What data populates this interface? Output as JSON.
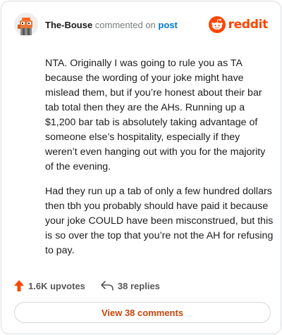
{
  "header": {
    "username": "The-Bouse",
    "action_text": "commented on",
    "post_link": "post",
    "logo_text": "reddit"
  },
  "comment": {
    "paragraphs": [
      "NTA. Originally I was going to rule you as TA because the wording of your joke might have mislead them, but if you’re honest about their bar tab total then they are the AHs. Running up a $1,200 bar tab is absolutely taking advantage of someone else’s hospitality, especially if they weren’t even hanging out with you for the majority of the evening.",
      "Had they run up a tab of only a few hundred dollars then tbh you probably should have paid it because your joke COULD have been misconstrued, but this is so over the top that you’re not the AH for refusing to pay."
    ]
  },
  "actions": {
    "upvotes": "1.6K upvotes",
    "replies": "38 replies",
    "view_comments": "View 38 comments"
  },
  "colors": {
    "brand": "#ff4500",
    "link": "#0079d3",
    "upvote_arrow": "#ff4500"
  },
  "icons": {
    "avatar": "user-avatar",
    "logo": "reddit-snoo-icon",
    "upvote": "upvote-arrow-icon",
    "reply": "reply-arrow-icon"
  }
}
